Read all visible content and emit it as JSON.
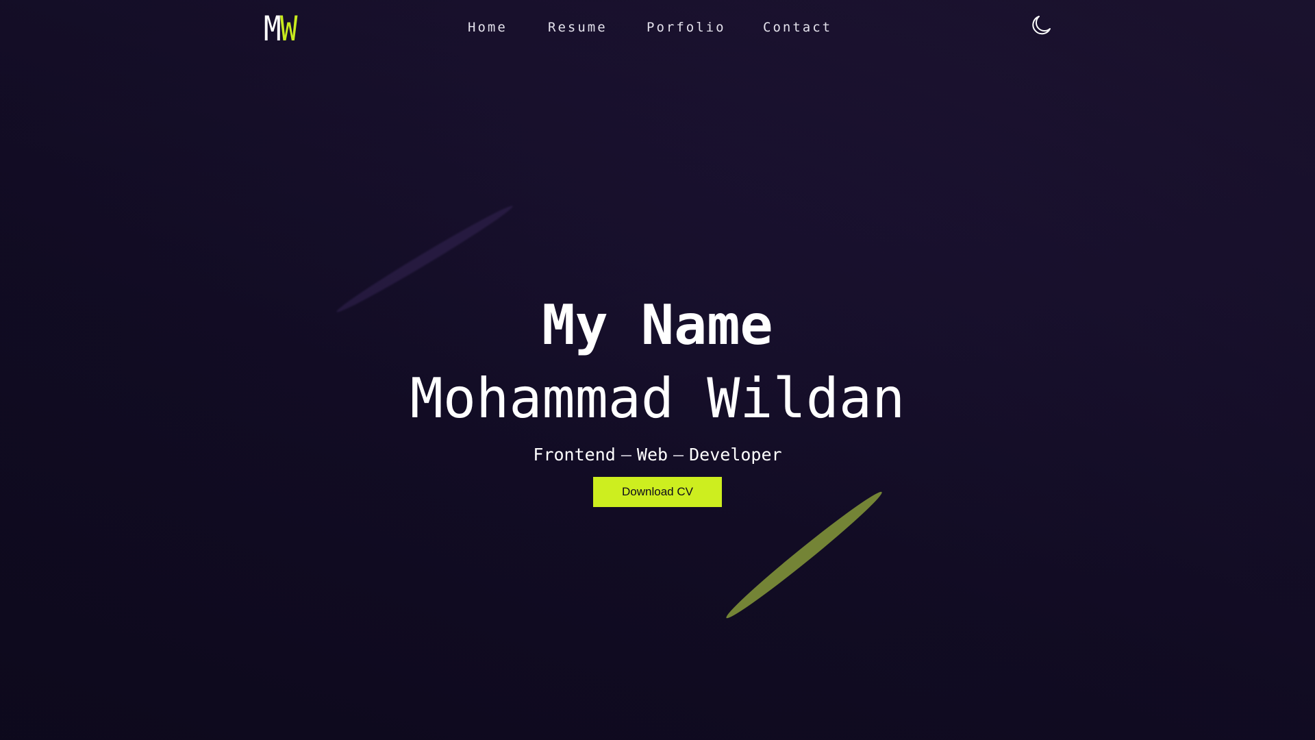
{
  "header": {
    "logo": {
      "first": "M",
      "second": "W"
    },
    "nav": {
      "home": "Home",
      "resume": "Resume",
      "portfolio": "Porfolio",
      "contact": "Contact"
    },
    "theme_icon": "moon-icon"
  },
  "hero": {
    "title": "My Name",
    "name": "Mohammad Wildan",
    "roles": [
      "Frontend",
      "Web",
      "Developer"
    ],
    "separator": "–",
    "cta_label": "Download CV"
  },
  "colors": {
    "background": "#1a1230",
    "accent": "#cdee1f",
    "text": "#ffffff",
    "streak_accent": "#748436"
  }
}
